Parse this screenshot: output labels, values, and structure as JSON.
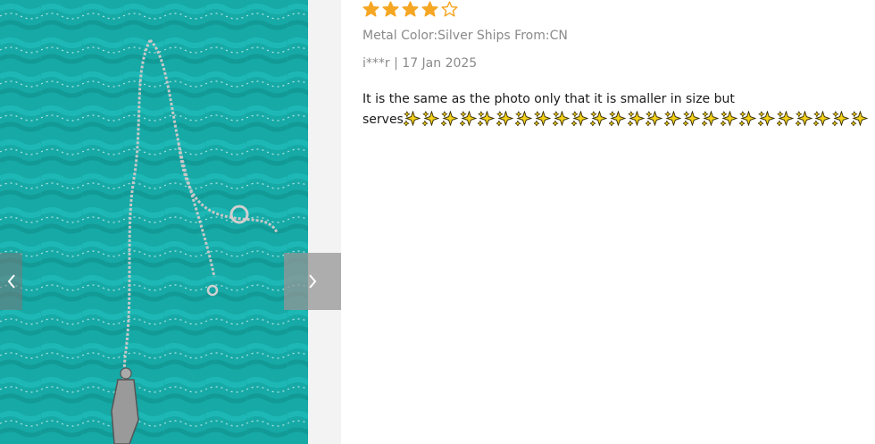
{
  "review": {
    "rating": 4,
    "max_rating": 5,
    "variant": "Metal Color:Silver Ships From:CN",
    "author": "i***r",
    "separator": "|",
    "date": "17 Jan 2025",
    "text_line1": "It is the same as the photo only that it is smaller in size but",
    "text_line2": "serves",
    "sparkle_count": 25
  },
  "gallery": {
    "prev_icon": "chevron-left-icon",
    "next_icon": "chevron-right-icon",
    "photo_subject": "silver chain necklace on teal fabric"
  },
  "colors": {
    "star": "#f5a623",
    "photo_bg": "#16a9a6",
    "muted_text": "#8a8a8a"
  }
}
